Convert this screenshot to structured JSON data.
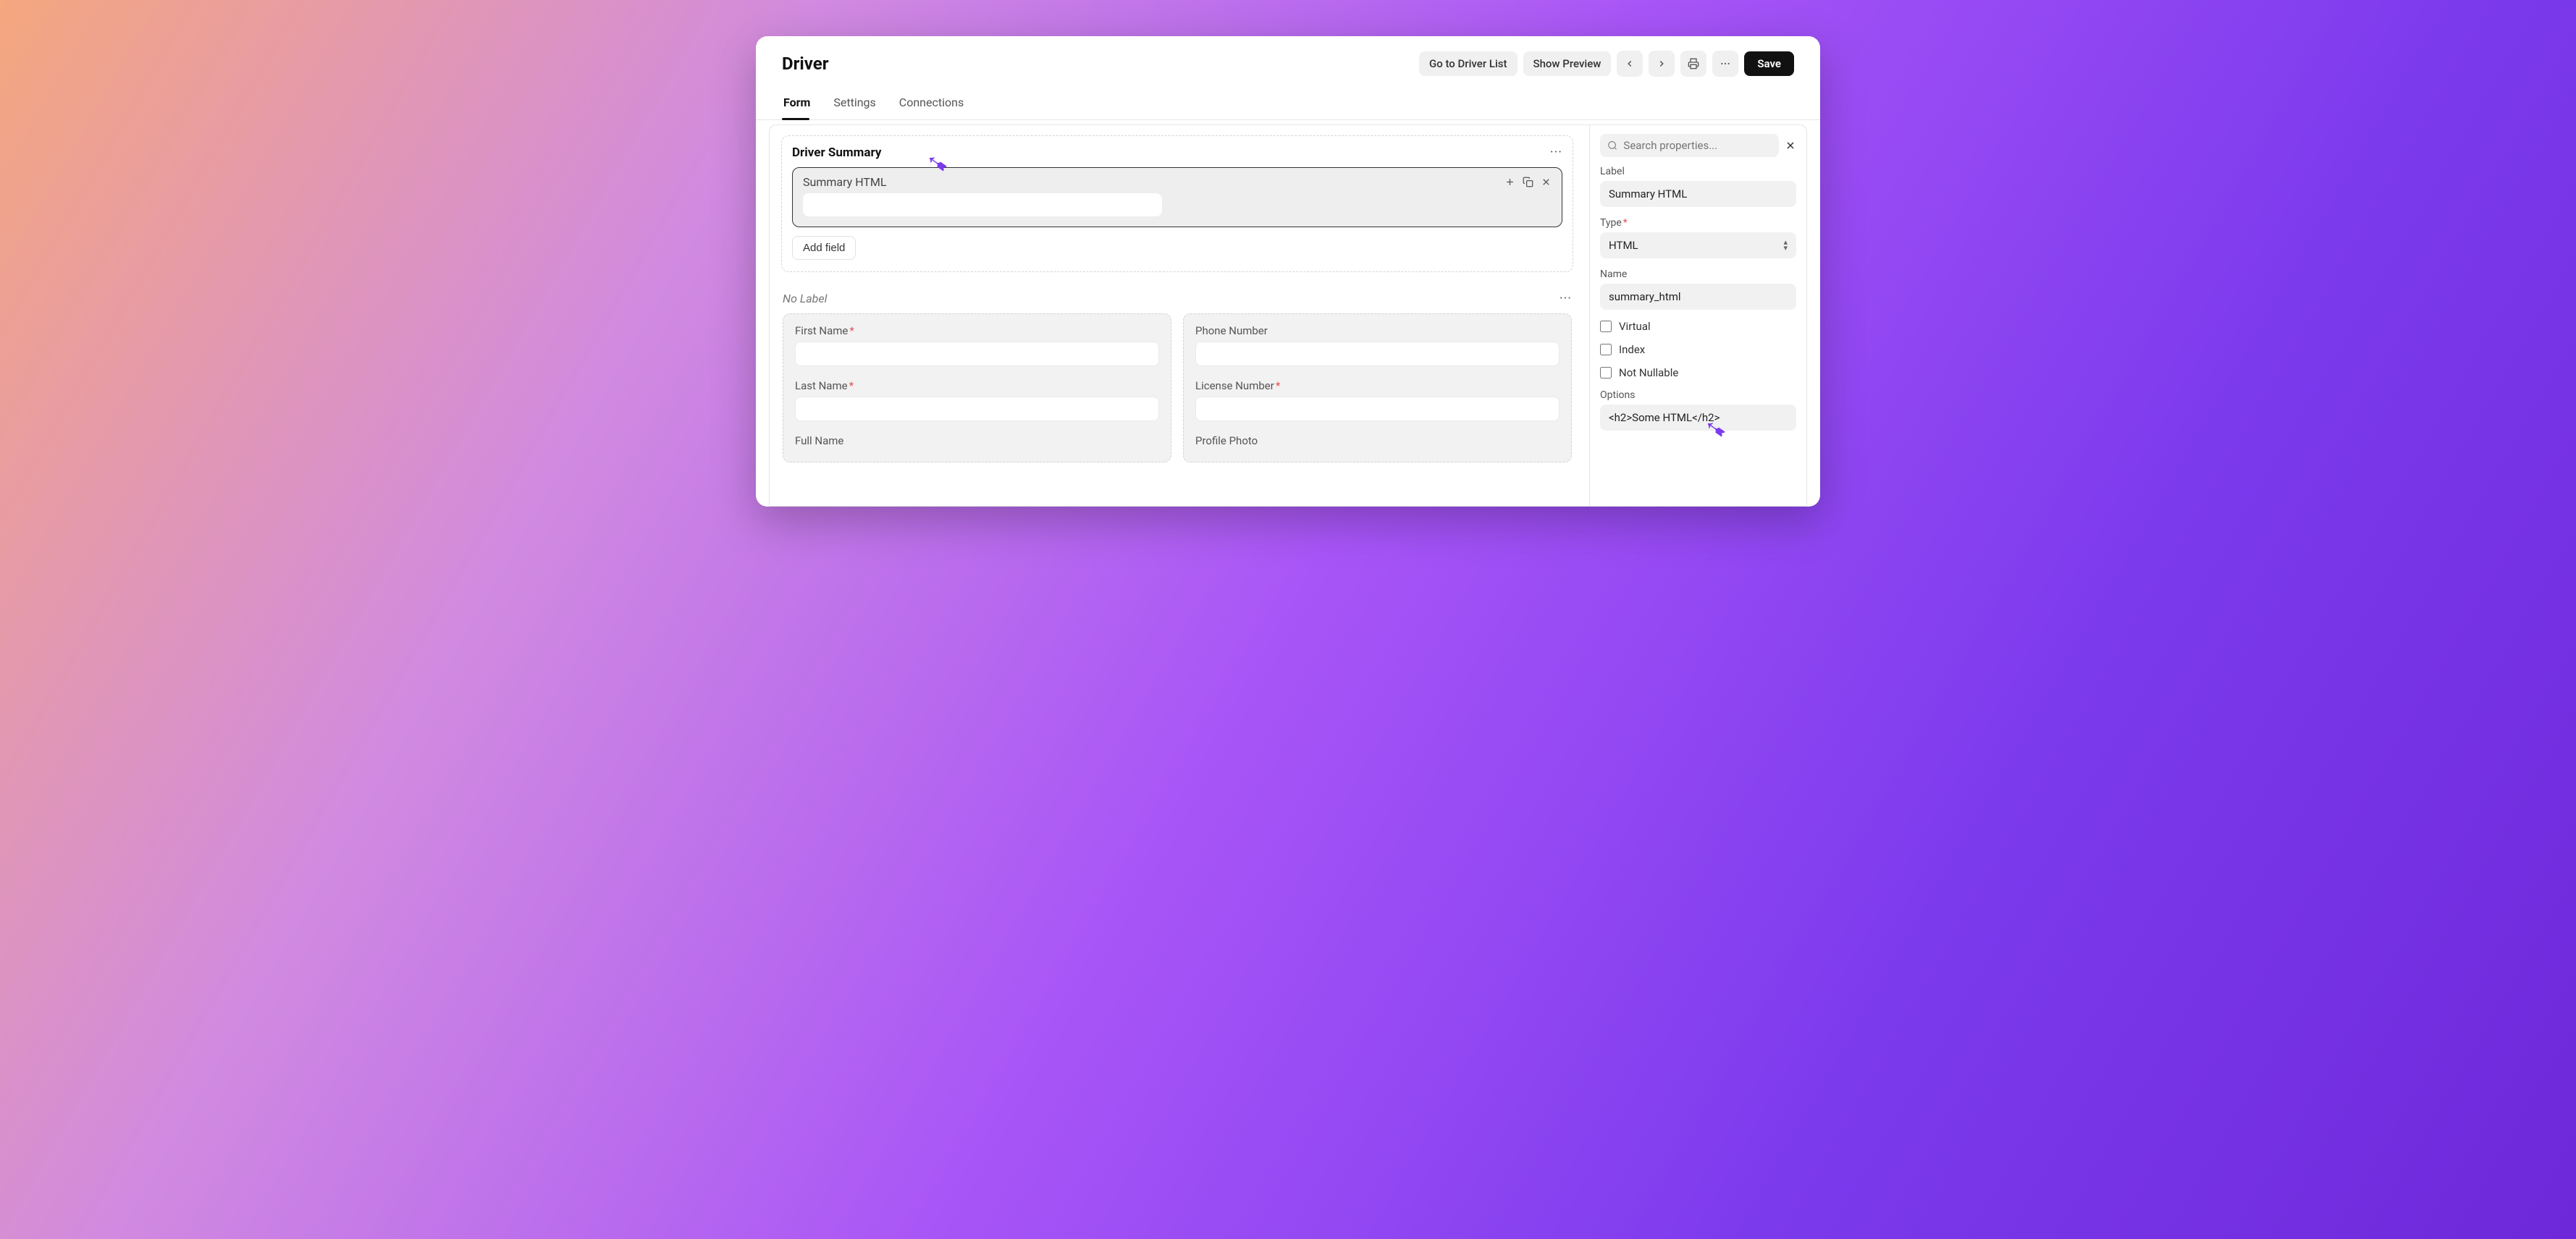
{
  "header": {
    "title": "Driver",
    "go_to_list": "Go to Driver List",
    "show_preview": "Show Preview",
    "save": "Save"
  },
  "tabs": {
    "form": "Form",
    "settings": "Settings",
    "connections": "Connections"
  },
  "section_summary": {
    "title": "Driver Summary",
    "selected_field_label": "Summary HTML",
    "add_field": "Add field"
  },
  "section_nolabel": {
    "title": "No Label",
    "left": {
      "first_name": "First Name",
      "last_name": "Last Name",
      "full_name": "Full Name"
    },
    "right": {
      "phone": "Phone Number",
      "license": "License Number",
      "photo": "Profile Photo"
    }
  },
  "panel": {
    "search_placeholder": "Search properties...",
    "label_lbl": "Label",
    "label_val": "Summary HTML",
    "type_lbl": "Type",
    "type_val": "HTML",
    "name_lbl": "Name",
    "name_val": "summary_html",
    "virtual": "Virtual",
    "index": "Index",
    "not_nullable": "Not Nullable",
    "options_lbl": "Options",
    "options_val": "<h2>Some HTML</h2>"
  }
}
